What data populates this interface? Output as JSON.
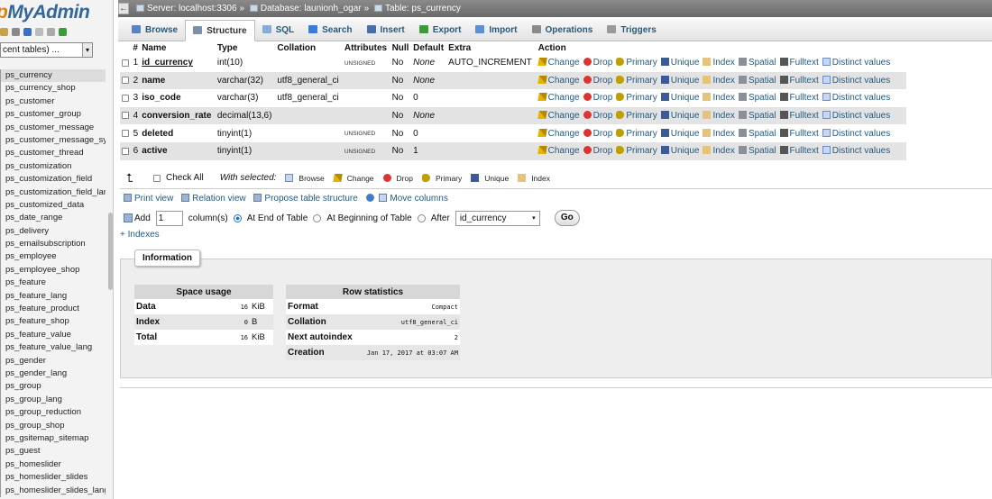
{
  "sidebar": {
    "logo_prefix": "p",
    "logo_main": "MyAdmin",
    "recent_select": "cent tables) ...",
    "tables": [
      "ps_currency",
      "ps_currency_shop",
      "ps_customer",
      "ps_customer_group",
      "ps_customer_message",
      "ps_customer_message_sy",
      "ps_customer_thread",
      "ps_customization",
      "ps_customization_field",
      "ps_customization_field_lan",
      "ps_customized_data",
      "ps_date_range",
      "ps_delivery",
      "ps_emailsubscription",
      "ps_employee",
      "ps_employee_shop",
      "ps_feature",
      "ps_feature_lang",
      "ps_feature_product",
      "ps_feature_shop",
      "ps_feature_value",
      "ps_feature_value_lang",
      "ps_gender",
      "ps_gender_lang",
      "ps_group",
      "ps_group_lang",
      "ps_group_reduction",
      "ps_group_shop",
      "ps_gsitemap_sitemap",
      "ps_guest",
      "ps_homeslider",
      "ps_homeslider_slides",
      "ps_homeslider_slides_lang"
    ],
    "active_index": 0
  },
  "breadcrumb": {
    "back": "←",
    "server": "Server: localhost:3306",
    "database": "Database: launionh_ogar",
    "table": "Table: ps_currency",
    "separator": "»"
  },
  "tabs": [
    {
      "label": "Browse",
      "color": "#5b83c4"
    },
    {
      "label": "Structure",
      "color": "#7a8fa8"
    },
    {
      "label": "SQL",
      "color": "#8aa9d6"
    },
    {
      "label": "Search",
      "color": "#3a7bd5"
    },
    {
      "label": "Insert",
      "color": "#4a6fa8"
    },
    {
      "label": "Export",
      "color": "#3c9a3c"
    },
    {
      "label": "Import",
      "color": "#5b8fd6"
    },
    {
      "label": "Operations",
      "color": "#8a8a8a"
    },
    {
      "label": "Triggers",
      "color": "#9a9a9a"
    }
  ],
  "active_tab": 1,
  "structure": {
    "headers": [
      "#",
      "Name",
      "Type",
      "Collation",
      "Attributes",
      "Null",
      "Default",
      "Extra",
      "Action"
    ],
    "rows": [
      {
        "num": "1",
        "name": "id_currency",
        "pk": true,
        "type": "int(10)",
        "collation": "",
        "attributes": "UNSIGNED",
        "null": "No",
        "default": "None",
        "default_italic": true,
        "extra": "AUTO_INCREMENT"
      },
      {
        "num": "2",
        "name": "name",
        "pk": false,
        "type": "varchar(32)",
        "collation": "utf8_general_ci",
        "attributes": "",
        "null": "No",
        "default": "None",
        "default_italic": true,
        "extra": ""
      },
      {
        "num": "3",
        "name": "iso_code",
        "pk": false,
        "type": "varchar(3)",
        "collation": "utf8_general_ci",
        "attributes": "",
        "null": "No",
        "default": "0",
        "default_italic": false,
        "extra": ""
      },
      {
        "num": "4",
        "name": "conversion_rate",
        "pk": false,
        "type": "decimal(13,6)",
        "collation": "",
        "attributes": "",
        "null": "No",
        "default": "None",
        "default_italic": true,
        "extra": ""
      },
      {
        "num": "5",
        "name": "deleted",
        "pk": false,
        "type": "tinyint(1)",
        "collation": "",
        "attributes": "UNSIGNED",
        "null": "No",
        "default": "0",
        "default_italic": false,
        "extra": ""
      },
      {
        "num": "6",
        "name": "active",
        "pk": false,
        "type": "tinyint(1)",
        "collation": "",
        "attributes": "UNSIGNED",
        "null": "No",
        "default": "1",
        "default_italic": false,
        "extra": ""
      }
    ],
    "actions": [
      {
        "label": "Change",
        "icon": "pencil-icon",
        "cls": "i-change"
      },
      {
        "label": "Drop",
        "icon": "drop-icon",
        "cls": "i-drop"
      },
      {
        "label": "Primary",
        "icon": "key-icon",
        "cls": "i-primary"
      },
      {
        "label": "Unique",
        "icon": "unique-icon",
        "cls": "i-unique"
      },
      {
        "label": "Index",
        "icon": "index-icon",
        "cls": "i-index"
      },
      {
        "label": "Spatial",
        "icon": "spatial-icon",
        "cls": "i-spatial"
      },
      {
        "label": "Fulltext",
        "icon": "fulltext-icon",
        "cls": "i-fulltext"
      },
      {
        "label": "Distinct values",
        "icon": "distinct-icon",
        "cls": "i-distinct"
      }
    ]
  },
  "with_selected": {
    "check_all": "Check All",
    "label": "With selected:",
    "actions": [
      "Browse",
      "Change",
      "Drop",
      "Primary",
      "Unique",
      "Index"
    ]
  },
  "links": {
    "print_view": "Print view",
    "relation_view": "Relation view",
    "propose": "Propose table structure",
    "move_columns": "Move columns"
  },
  "add_columns": {
    "add": "Add",
    "count": "1",
    "columns_label": "column(s)",
    "at_end": "At End of Table",
    "at_beginning": "At Beginning of Table",
    "after": "After",
    "after_field": "id_currency",
    "go": "Go"
  },
  "indexes_link": "+ Indexes",
  "information": {
    "legend": "Information",
    "space_usage": {
      "title": "Space usage",
      "rows": [
        {
          "key": "Data",
          "value": "16",
          "unit": "KiB"
        },
        {
          "key": "Index",
          "value": "0",
          "unit": "B"
        },
        {
          "key": "Total",
          "value": "16",
          "unit": "KiB"
        }
      ]
    },
    "row_statistics": {
      "title": "Row statistics",
      "rows": [
        {
          "key": "Format",
          "value": "Compact"
        },
        {
          "key": "Collation",
          "value": "utf8_general_ci"
        },
        {
          "key": "Next autoindex",
          "value": "2"
        },
        {
          "key": "Creation",
          "value": "Jan 17, 2017 at 03:07 AM"
        }
      ]
    }
  }
}
